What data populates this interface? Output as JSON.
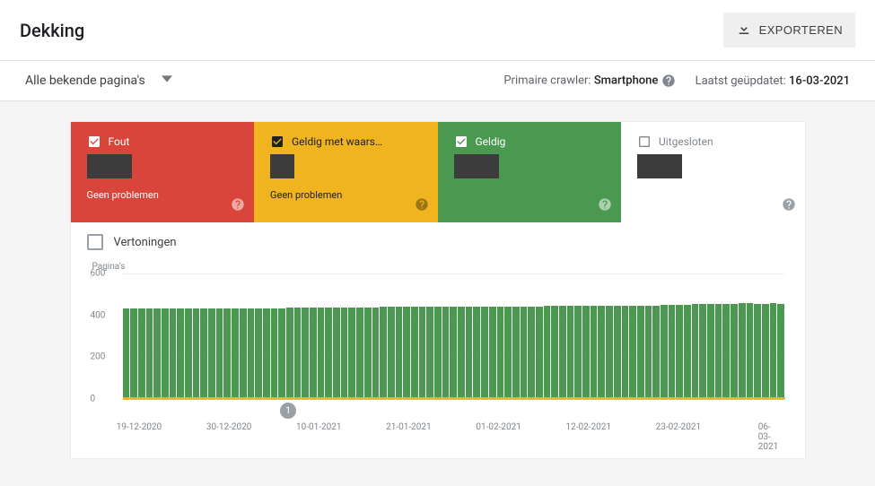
{
  "header": {
    "title": "Dekking",
    "export_label": "EXPORTEREN"
  },
  "filter": {
    "dropdown_label": "Alle bekende pagina's",
    "crawler_label": "Primaire crawler:",
    "crawler_value": "Smartphone",
    "updated_label": "Laatst geüpdatet:",
    "updated_value": "16-03-2021"
  },
  "tiles": {
    "error": {
      "label": "Fout",
      "checked": true,
      "sub": "Geen problemen"
    },
    "warning": {
      "label": "Geldig met waars…",
      "checked": true,
      "sub": "Geen problemen"
    },
    "valid": {
      "label": "Geldig",
      "checked": true,
      "sub": ""
    },
    "excluded": {
      "label": "Uitgesloten",
      "checked": false,
      "sub": ""
    }
  },
  "impressions_label": "Vertoningen",
  "chart_data": {
    "type": "bar",
    "ylabel": "Pagina's",
    "ylim": [
      0,
      600
    ],
    "yticks": [
      0,
      200,
      400,
      600
    ],
    "x_tick_labels": [
      "19-12-2020",
      "30-12-2020",
      "10-01-2021",
      "21-01-2021",
      "01-02-2021",
      "12-02-2021",
      "23-02-2021",
      "06-03-2021"
    ],
    "event_markers": [
      {
        "index_pct": 25,
        "label": "1"
      }
    ],
    "values": [
      432,
      432,
      432,
      432,
      432,
      432,
      432,
      432,
      432,
      432,
      432,
      432,
      432,
      432,
      432,
      432,
      432,
      432,
      432,
      432,
      432,
      438,
      438,
      436,
      438,
      438,
      438,
      438,
      438,
      438,
      438,
      438,
      438,
      440,
      440,
      440,
      440,
      440,
      440,
      440,
      440,
      440,
      440,
      440,
      440,
      440,
      442,
      442,
      442,
      442,
      442,
      442,
      442,
      442,
      444,
      444,
      444,
      444,
      444,
      444,
      444,
      446,
      446,
      446,
      446,
      446,
      446,
      446,
      446,
      448,
      448,
      448,
      450,
      456,
      456,
      454,
      454,
      454,
      456,
      458,
      458,
      456,
      456,
      460,
      455
    ]
  }
}
